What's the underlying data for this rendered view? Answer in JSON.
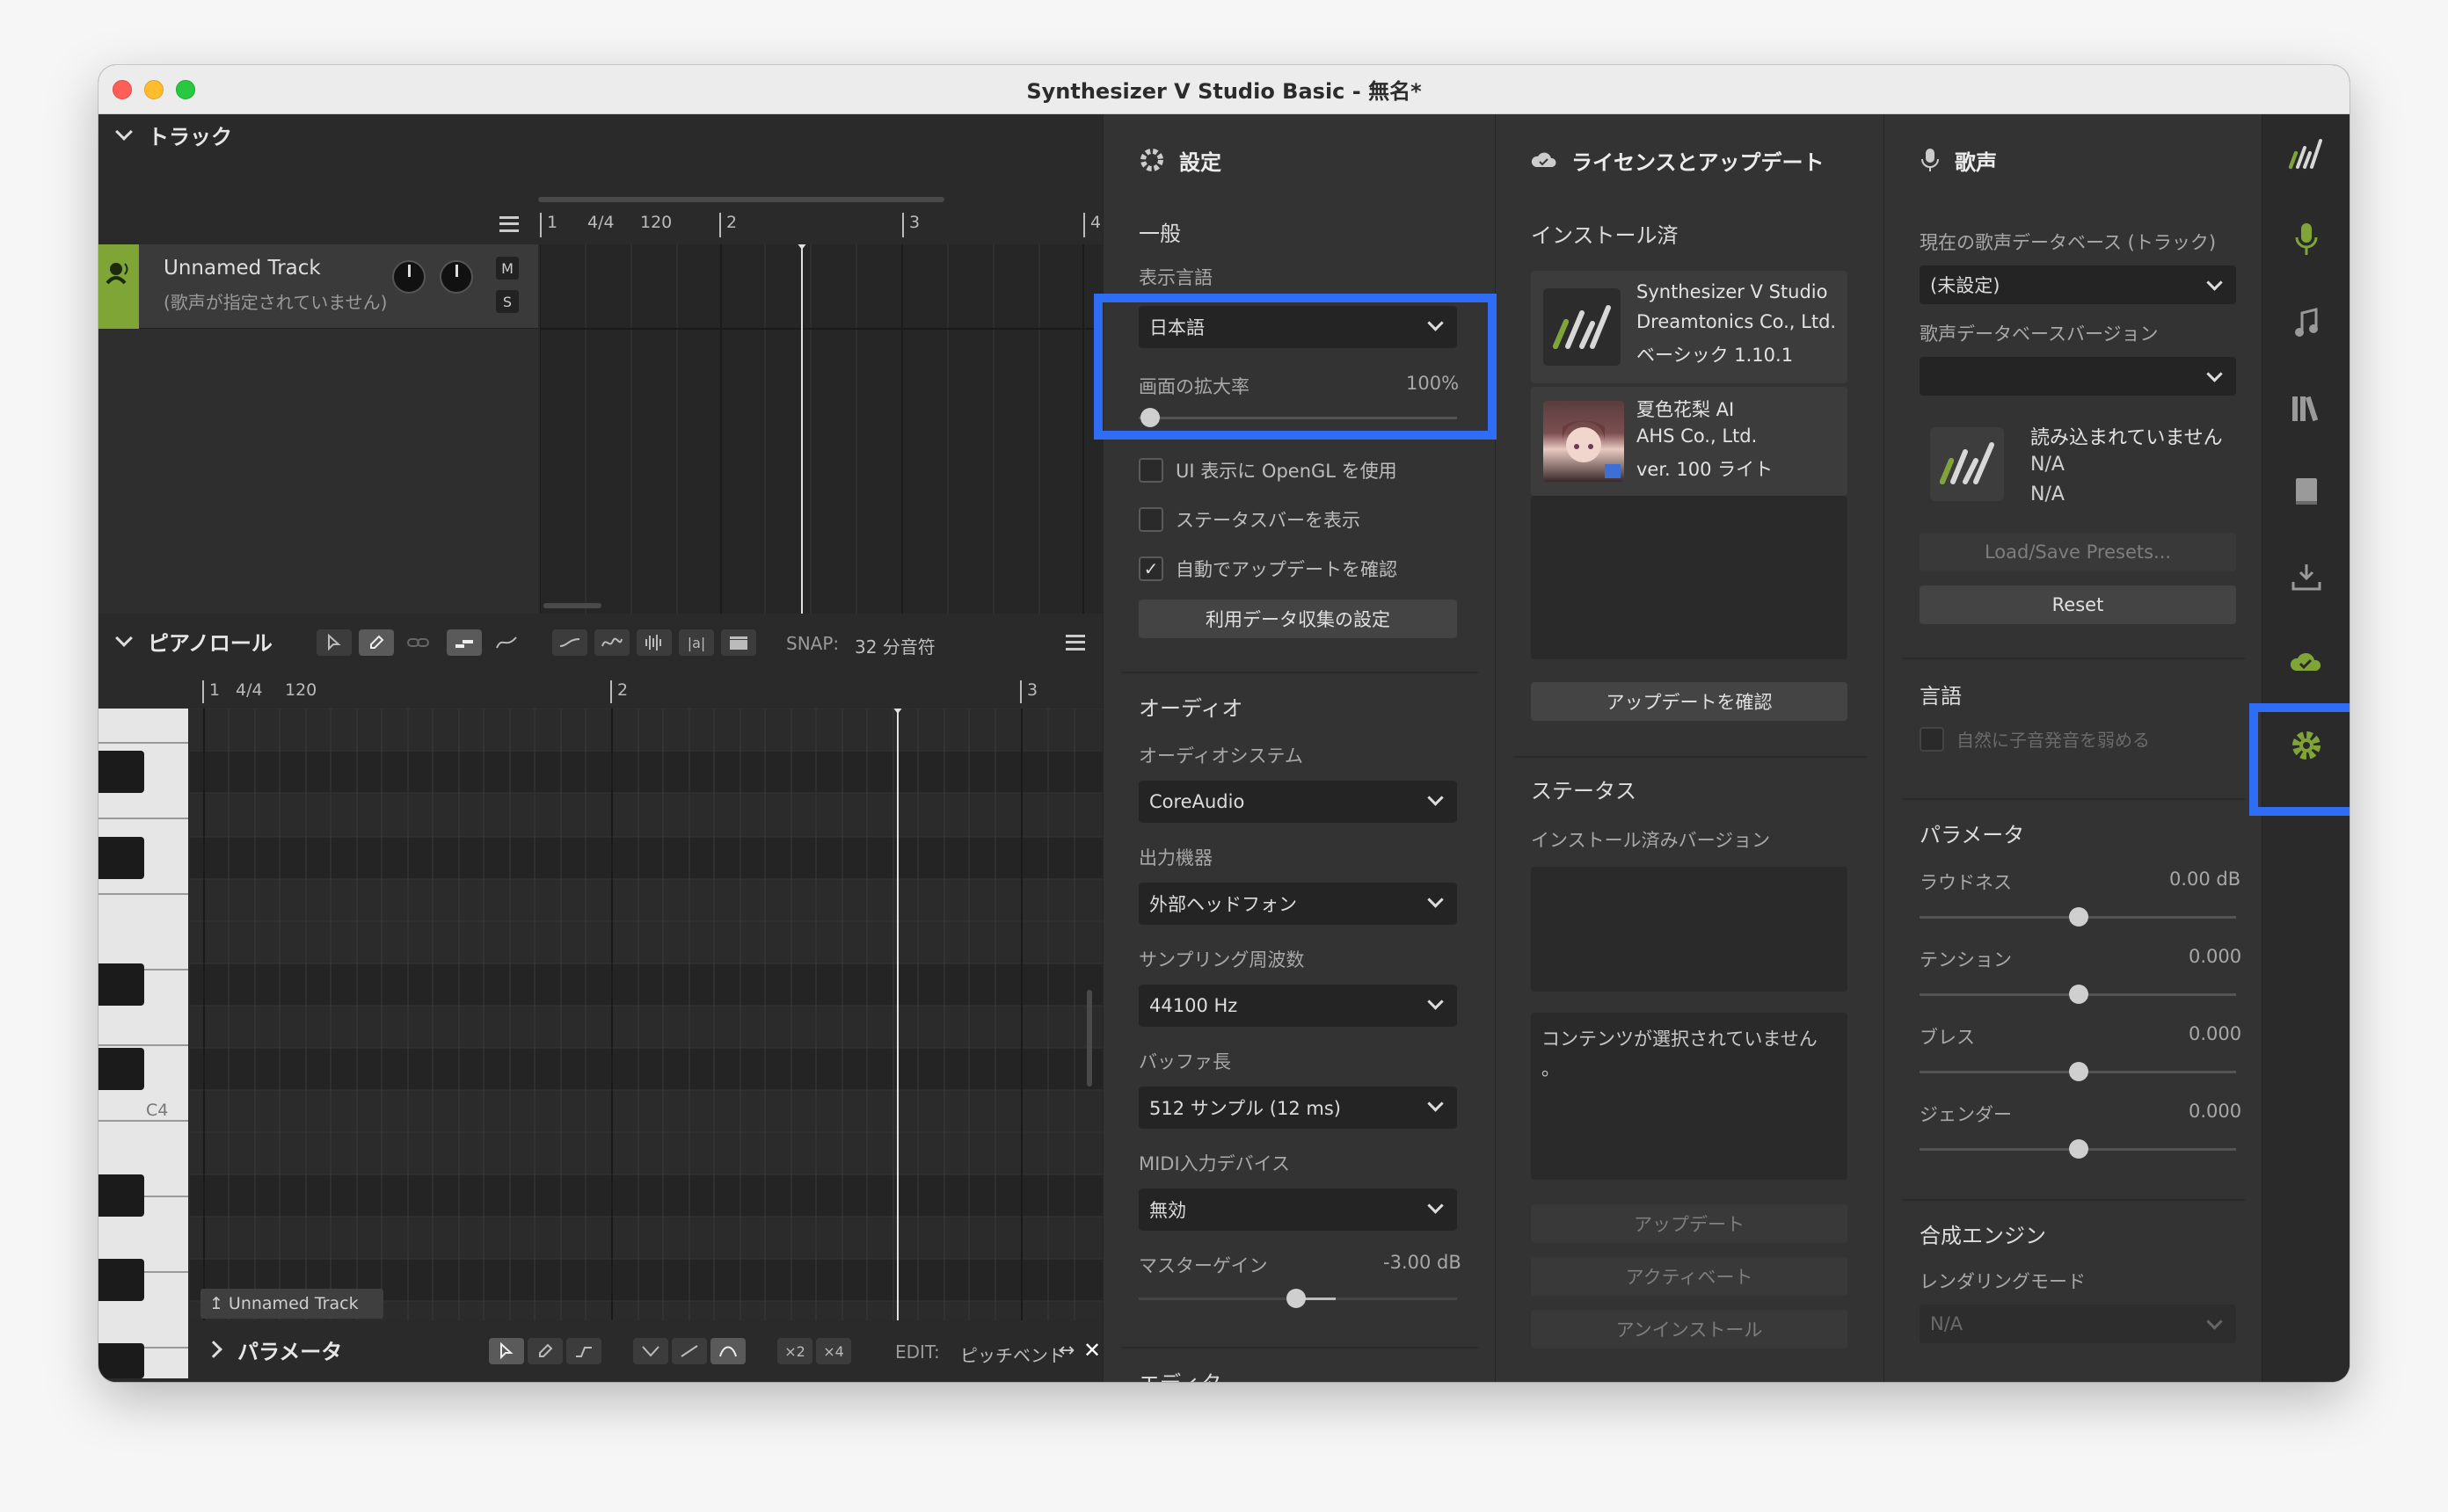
{
  "window": {
    "title": "Synthesizer V Studio Basic - 無名*"
  },
  "track_panel": {
    "header": "トラック",
    "track": {
      "name": "Unnamed Track",
      "voice": "(歌声が指定されていません)",
      "mute": "M",
      "solo": "S"
    },
    "ruler": {
      "m1": "1",
      "ts": "4/4",
      "tempo": "120",
      "m2": "2",
      "m3": "3",
      "m4": "4"
    }
  },
  "piano_roll": {
    "header": "ピアノロール",
    "snap_label": "SNAP:",
    "snap_value": "32 分音符",
    "ruler": {
      "m1": "1",
      "ts": "4/4",
      "tempo": "120",
      "m2": "2",
      "m3": "3"
    },
    "c4_label": "C4",
    "track_tag": "Unnamed Track",
    "lyrics_btn": "|a|"
  },
  "param_bar": {
    "header": "パラメータ",
    "x2": "×2",
    "x4": "×4",
    "edit_label": "EDIT:",
    "edit_value": "ピッチベンド"
  },
  "settings": {
    "header": "設定",
    "general": "一般",
    "language_label": "表示言語",
    "language_value": "日本語",
    "zoom_label": "画面の拡大率",
    "zoom_value": "100%",
    "opengl": "UI 表示に OpenGL を使用",
    "statusbar": "ステータスバーを表示",
    "autoupdate": "自動でアップデートを確認",
    "data_collection": "利用データ収集の設定",
    "audio": "オーディオ",
    "audio_system_label": "オーディオシステム",
    "audio_system_value": "CoreAudio",
    "output_label": "出力機器",
    "output_value": "外部ヘッドフォン",
    "sample_rate_label": "サンプリング周波数",
    "sample_rate_value": "44100 Hz",
    "buffer_label": "バッファ長",
    "buffer_value": "512 サンプル (12 ms)",
    "midi_label": "MIDI入力デバイス",
    "midi_value": "無効",
    "gain_label": "マスターゲイン",
    "gain_value": "-3.00 dB",
    "editor": "エディタ"
  },
  "license": {
    "header": "ライセンスとアップデート",
    "installed": "インストール済",
    "items": [
      {
        "name": "Synthesizer V Studio",
        "company": "Dreamtonics Co., Ltd.",
        "version": "ベーシック 1.10.1"
      },
      {
        "name": "夏色花梨 AI",
        "company": "AHS Co., Ltd.",
        "version": "ver. 100 ライト"
      }
    ],
    "check_update": "アップデートを確認",
    "status": "ステータス",
    "installed_version": "インストール済みバージョン",
    "no_content": "コンテンツが選択されていません",
    "no_content_tail": "。",
    "update": "アップデート",
    "activate": "アクティベート",
    "uninstall": "アンインストール"
  },
  "voice": {
    "header": "歌声",
    "current_db_label": "現在の歌声データベース (トラック)",
    "current_db_value": "(未設定)",
    "db_version_label": "歌声データベースバージョン",
    "not_loaded": "読み込まれていません",
    "na1": "N/A",
    "na2": "N/A",
    "presets": "Load/Save Presets...",
    "reset": "Reset",
    "language": "言語",
    "weaken_consonant": "自然に子音発音を弱める",
    "parameters": "パラメータ",
    "loudness_label": "ラウドネス",
    "loudness_value": "0.00 dB",
    "tension_label": "テンション",
    "tension_value": "0.000",
    "breath_label": "ブレス",
    "breath_value": "0.000",
    "gender_label": "ジェンダー",
    "gender_value": "0.000",
    "engine": "合成エンジン",
    "render_mode_label": "レンダリングモード",
    "render_mode_value": "N/A"
  },
  "colors": {
    "accent_green": "#7ea536",
    "highlight_blue": "#2f6df6"
  }
}
